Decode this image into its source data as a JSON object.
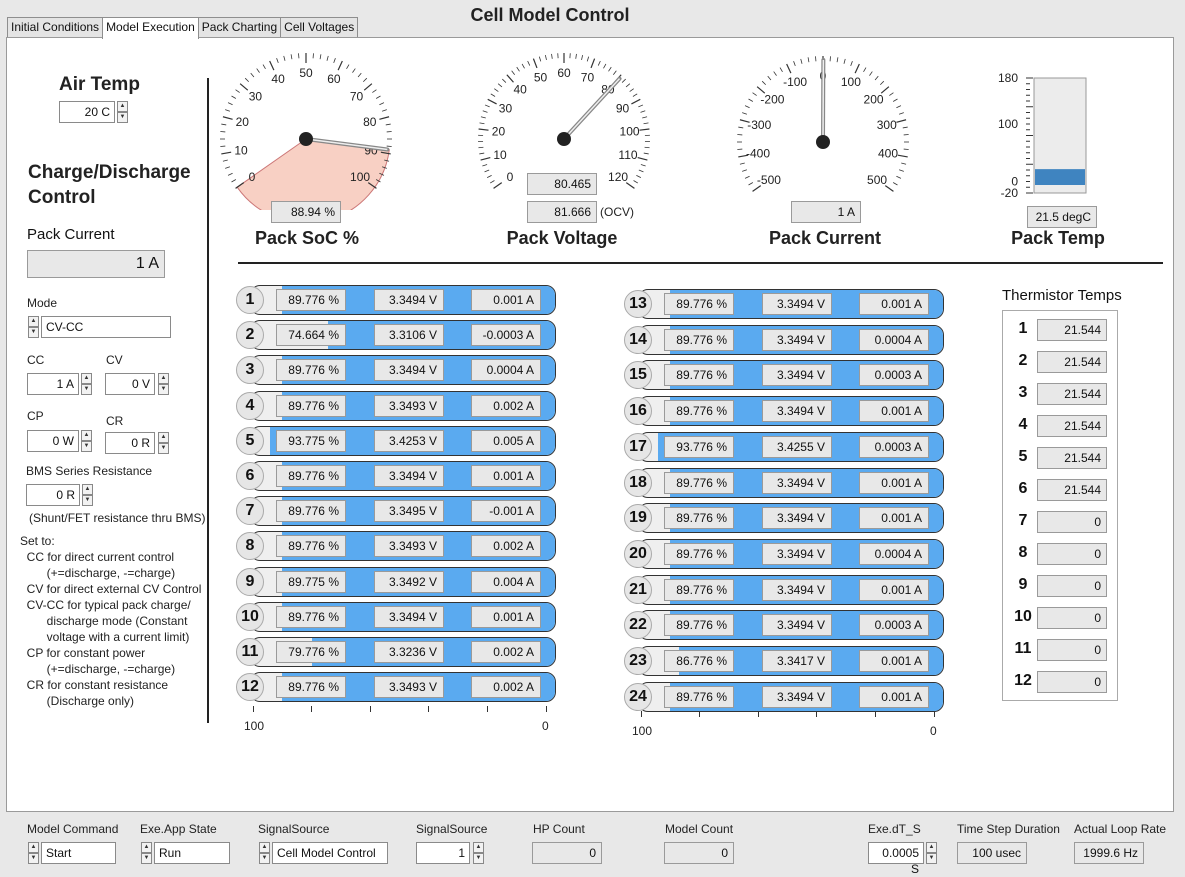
{
  "window": {
    "title": "Cell Model Control"
  },
  "tabs": [
    {
      "label": "Initial Conditions",
      "active": false
    },
    {
      "label": "Model Execution",
      "active": true
    },
    {
      "label": "Pack Charting",
      "active": false
    },
    {
      "label": "Cell Voltages",
      "active": false
    }
  ],
  "left": {
    "air_temp_label": "Air Temp",
    "air_temp_value": "20 C",
    "charge_title_line1": "Charge/Discharge",
    "charge_title_line2": "Control",
    "pack_current_label": "Pack Current",
    "pack_current_value": "1 A",
    "mode_label": "Mode",
    "mode_value": "CV-CC",
    "cc_label": "CC",
    "cc_value": "1 A",
    "cv_label": "CV",
    "cv_value": "0 V",
    "cp_label": "CP",
    "cp_value": "0 W",
    "cr_label": "CR",
    "cr_value": "0 R",
    "bms_label": "BMS Series Resistance",
    "bms_value": "0 R",
    "bms_note": "(Shunt/FET resistance thru BMS)",
    "help": [
      "Set to:",
      "  CC for direct current control",
      "        (+=discharge, -=charge)",
      "  CV for direct external CV Control",
      "  CV-CC for typical pack charge/",
      "        discharge mode (Constant",
      "        voltage with a current limit)",
      "  CP for constant power",
      "        (+=discharge, -=charge)",
      "  CR for constant resistance",
      "        (Discharge only)"
    ]
  },
  "gauges": {
    "soc": {
      "label": "Pack SoC %",
      "value_text": "88.94 %",
      "value": 88.94,
      "min": 0,
      "max": 100,
      "ticks": [
        "0",
        "10",
        "20",
        "30",
        "40",
        "50",
        "60",
        "70",
        "80",
        "90",
        "100"
      ],
      "pointer_color": "#f8d0c4"
    },
    "voltage": {
      "label": "Pack Voltage",
      "value_text": "80.465",
      "ocv_text": "81.666",
      "ocv_suffix": "(OCV)",
      "value": 80.465,
      "min": 0,
      "max": 120,
      "ticks": [
        "0",
        "10",
        "20",
        "30",
        "40",
        "50",
        "60",
        "70",
        "80",
        "90",
        "100",
        "110",
        "120"
      ]
    },
    "current": {
      "label": "Pack Current",
      "value_text": "1 A",
      "value": 1,
      "min": -500,
      "max": 500,
      "ticks": [
        "-500",
        "-400",
        "-300",
        "-200",
        "-100",
        "0",
        "100",
        "200",
        "300",
        "400",
        "500"
      ]
    },
    "temp": {
      "label": "Pack Temp",
      "value_text": "21.5 degC",
      "value": 21.5,
      "min": -20,
      "max": 180,
      "ticks": [
        "180",
        "100",
        "0",
        "-20"
      ],
      "fill_color": "#3f84c0"
    }
  },
  "cells": [
    {
      "n": "1",
      "soc": "89.776 %",
      "v": "3.3494 V",
      "i": "0.001 A",
      "fill": 89.776
    },
    {
      "n": "2",
      "soc": "74.664 %",
      "v": "3.3106 V",
      "i": "-0.0003 A",
      "fill": 74.664
    },
    {
      "n": "3",
      "soc": "89.776 %",
      "v": "3.3494 V",
      "i": "0.0004 A",
      "fill": 89.776
    },
    {
      "n": "4",
      "soc": "89.776 %",
      "v": "3.3493 V",
      "i": "0.002 A",
      "fill": 89.776
    },
    {
      "n": "5",
      "soc": "93.775 %",
      "v": "3.4253 V",
      "i": "0.005 A",
      "fill": 93.775
    },
    {
      "n": "6",
      "soc": "89.776 %",
      "v": "3.3494 V",
      "i": "0.001 A",
      "fill": 89.776
    },
    {
      "n": "7",
      "soc": "89.776 %",
      "v": "3.3495 V",
      "i": "-0.001 A",
      "fill": 89.776
    },
    {
      "n": "8",
      "soc": "89.776 %",
      "v": "3.3493 V",
      "i": "0.002 A",
      "fill": 89.776
    },
    {
      "n": "9",
      "soc": "89.775 %",
      "v": "3.3492 V",
      "i": "0.004 A",
      "fill": 89.775
    },
    {
      "n": "10",
      "soc": "89.776 %",
      "v": "3.3494 V",
      "i": "0.001 A",
      "fill": 89.776
    },
    {
      "n": "11",
      "soc": "79.776 %",
      "v": "3.3236 V",
      "i": "0.002 A",
      "fill": 79.776
    },
    {
      "n": "12",
      "soc": "89.776 %",
      "v": "3.3493 V",
      "i": "0.002 A",
      "fill": 89.776
    },
    {
      "n": "13",
      "soc": "89.776 %",
      "v": "3.3494 V",
      "i": "0.001 A",
      "fill": 89.776
    },
    {
      "n": "14",
      "soc": "89.776 %",
      "v": "3.3494 V",
      "i": "0.0004 A",
      "fill": 89.776
    },
    {
      "n": "15",
      "soc": "89.776 %",
      "v": "3.3494 V",
      "i": "0.0003 A",
      "fill": 89.776
    },
    {
      "n": "16",
      "soc": "89.776 %",
      "v": "3.3494 V",
      "i": "0.001 A",
      "fill": 89.776
    },
    {
      "n": "17",
      "soc": "93.776 %",
      "v": "3.4255 V",
      "i": "0.0003 A",
      "fill": 93.776
    },
    {
      "n": "18",
      "soc": "89.776 %",
      "v": "3.3494 V",
      "i": "0.001 A",
      "fill": 89.776
    },
    {
      "n": "19",
      "soc": "89.776 %",
      "v": "3.3494 V",
      "i": "0.001 A",
      "fill": 89.776
    },
    {
      "n": "20",
      "soc": "89.776 %",
      "v": "3.3494 V",
      "i": "0.0004 A",
      "fill": 89.776
    },
    {
      "n": "21",
      "soc": "89.776 %",
      "v": "3.3494 V",
      "i": "0.001 A",
      "fill": 89.776
    },
    {
      "n": "22",
      "soc": "89.776 %",
      "v": "3.3494 V",
      "i": "0.0003 A",
      "fill": 89.776
    },
    {
      "n": "23",
      "soc": "86.776 %",
      "v": "3.3417 V",
      "i": "0.001 A",
      "fill": 86.776
    },
    {
      "n": "24",
      "soc": "89.776 %",
      "v": "3.3494 V",
      "i": "0.001 A",
      "fill": 89.776
    }
  ],
  "cell_scale": {
    "left": "100",
    "right": "0"
  },
  "thermistors": {
    "title": "Thermistor Temps",
    "items": [
      {
        "n": "1",
        "v": "21.544"
      },
      {
        "n": "2",
        "v": "21.544"
      },
      {
        "n": "3",
        "v": "21.544"
      },
      {
        "n": "4",
        "v": "21.544"
      },
      {
        "n": "5",
        "v": "21.544"
      },
      {
        "n": "6",
        "v": "21.544"
      },
      {
        "n": "7",
        "v": "0"
      },
      {
        "n": "8",
        "v": "0"
      },
      {
        "n": "9",
        "v": "0"
      },
      {
        "n": "10",
        "v": "0"
      },
      {
        "n": "11",
        "v": "0"
      },
      {
        "n": "12",
        "v": "0"
      }
    ]
  },
  "bottom": {
    "model_command_label": "Model Command",
    "model_command_value": "Start",
    "app_state_label": "Exe.App State",
    "app_state_value": "Run",
    "signal_source_label": "SignalSource",
    "signal_source_value": "Cell Model Control",
    "signal_source2_label": "SignalSource",
    "signal_source2_value": "1",
    "hp_count_label": "HP Count",
    "hp_count_value": "0",
    "model_count_label": "Model Count",
    "model_count_value": "0",
    "exe_dt_label": "Exe.dT_S",
    "exe_dt_value": "0.0005 S",
    "time_step_label": "Time Step Duration",
    "time_step_value": "100 usec",
    "loop_rate_label": "Actual Loop Rate",
    "loop_rate_value": "1999.6 Hz"
  },
  "colors": {
    "cell_fill": "#5aaaf0",
    "panel_bg": "#ffffff",
    "window_bg": "#e8e8e8"
  }
}
